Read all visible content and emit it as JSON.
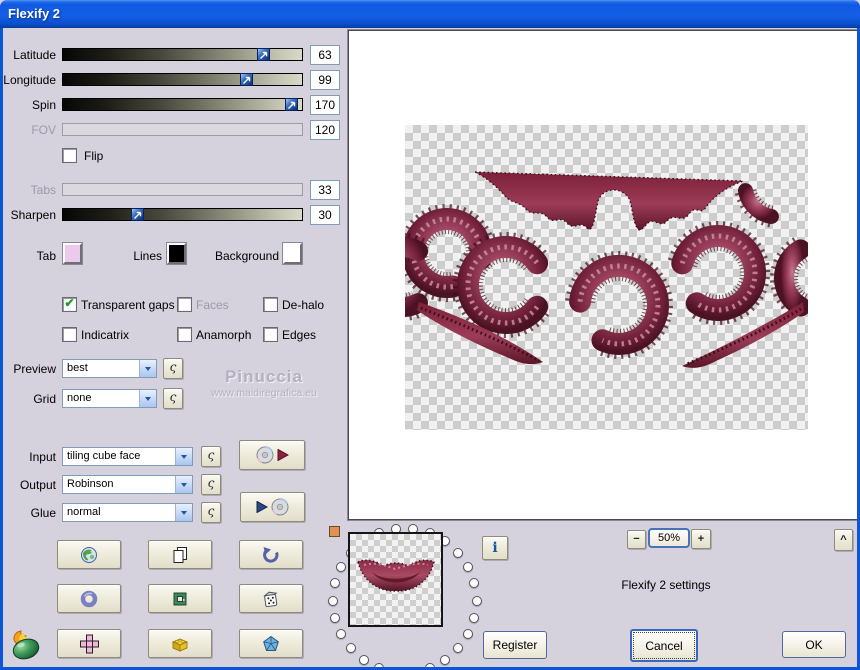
{
  "window": {
    "title": "Flexify 2"
  },
  "sliders": [
    {
      "label": "Latitude",
      "value": "63"
    },
    {
      "label": "Longitude",
      "value": "99"
    },
    {
      "label": "Spin",
      "value": "170"
    },
    {
      "label": "FOV",
      "value": "120"
    },
    {
      "label": "Tabs",
      "value": "33"
    },
    {
      "label": "Sharpen",
      "value": "30"
    }
  ],
  "flip": {
    "label": "Flip",
    "glyph": ""
  },
  "swatch_row": {
    "tab_label": "Tab",
    "lines_label": "Lines",
    "background_label": "Background",
    "tab_color": "#eccaec",
    "lines_color": "#000000",
    "background_color": "#ffffff"
  },
  "checkboxes": [
    {
      "label": "Transparent gaps",
      "glyph": "✔",
      "checked": true
    },
    {
      "label": "Faces",
      "glyph": "",
      "disabled": true
    },
    {
      "label": "De-halo",
      "glyph": ""
    },
    {
      "label": "Indicatrix",
      "glyph": ""
    },
    {
      "label": "Anamorph",
      "glyph": ""
    },
    {
      "label": "Edges",
      "glyph": ""
    }
  ],
  "selects": {
    "preview": {
      "label": "Preview",
      "value": "best"
    },
    "grid": {
      "label": "Grid",
      "value": "none"
    },
    "input": {
      "label": "Input",
      "value": "tiling cube face"
    },
    "output": {
      "label": "Output",
      "value": "Robinson"
    },
    "glue": {
      "label": "Glue",
      "value": "normal"
    }
  },
  "ui": {
    "random_glyph": "ς",
    "info_glyph": "i",
    "collapse_glyph": "^"
  },
  "watermark": {
    "line1": "Pinuccia",
    "line2": "www.maidiregrafica.eu"
  },
  "zoom": {
    "out": "−",
    "level": "50%",
    "in": "+"
  },
  "footer": {
    "settings_label": "Flexify 2 settings",
    "register": "Register",
    "cancel": "Cancel",
    "ok": "OK"
  },
  "colors": {
    "titlebar_blue": "#0b55d6",
    "body": "#d5d2de",
    "maroon": "#8c3350",
    "button_face": "#ece9d8"
  },
  "icons": [
    "flaming-pear-logo-icon",
    "planet-icon",
    "copy-pages-icon",
    "undo-arrow-icon",
    "ring-icon",
    "frame-icon",
    "dice-icon",
    "cube-net-icon",
    "lego-brick-icon",
    "polyhedron-icon",
    "cd-icon",
    "play-triangle-icon",
    "info-icon",
    "memory-dot",
    "dropdown-arrow-icon",
    "slider-thumb-arrow-icon"
  ]
}
